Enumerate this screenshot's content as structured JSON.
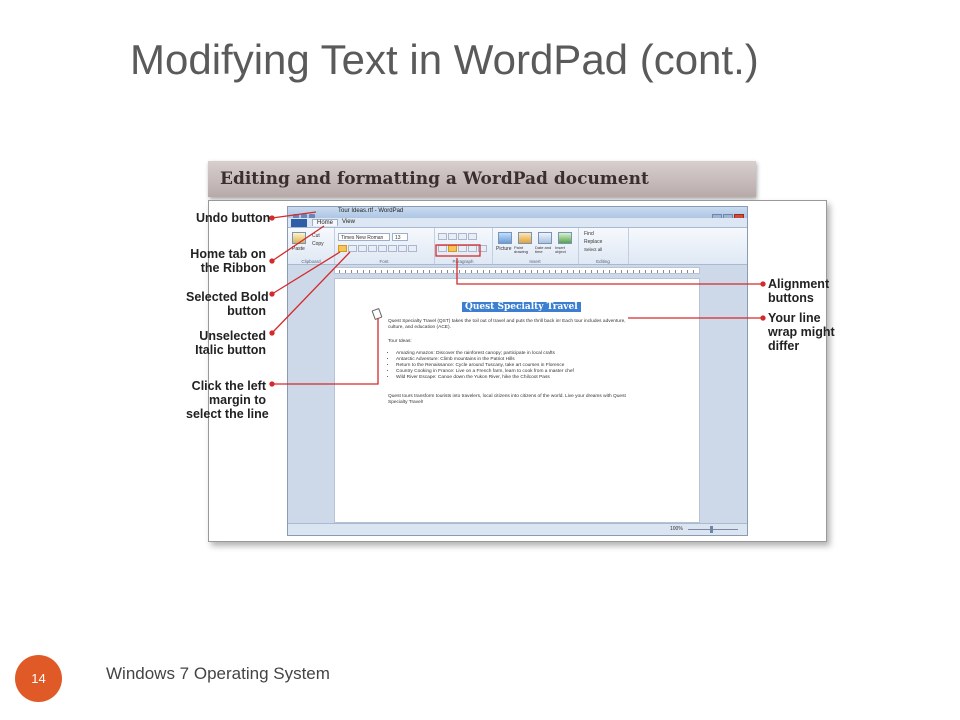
{
  "slide": {
    "title": "Modifying Text in WordPad (cont.)",
    "figure_caption": "Editing and formatting a WordPad document",
    "number": "14",
    "footer": "Windows 7 Operating System"
  },
  "callouts": {
    "undo": [
      "Undo button"
    ],
    "home_tab": [
      "Home tab on",
      "the Ribbon"
    ],
    "bold": [
      "Selected Bold",
      "button"
    ],
    "italic": [
      "Unselected",
      "Italic button"
    ],
    "margin": [
      "Click the left",
      "margin to",
      "select the line"
    ],
    "alignment": [
      "Alignment",
      "buttons"
    ],
    "wrap": [
      "Your line",
      "wrap might",
      "differ"
    ]
  },
  "window": {
    "title": "Tour Ideas.rtf - WordPad",
    "tabs": {
      "home": "Home",
      "view": "View"
    },
    "ribbon": {
      "paste": "Paste",
      "cut": "Cut",
      "copy": "Copy",
      "font_name": "Times New Roman",
      "font_size": "13",
      "picture": "Picture",
      "paint_drawing": "Paint drawing",
      "date_time": "Date and time",
      "insert_object": "Insert object",
      "find": "Find",
      "replace": "Replace",
      "select_all": "Select all",
      "groups": {
        "clipboard": "Clipboard",
        "font": "Font",
        "paragraph": "Paragraph",
        "insert": "Insert",
        "editing": "Editing"
      }
    },
    "status": {
      "zoom": "100%"
    }
  },
  "document": {
    "title": "Quest Specialty Travel",
    "intro": "Quest Specialty Travel (QST) takes the toil out of travel and puts the thrill back in! Each tour includes adventure, culture, and education (ACE).",
    "tour_heading": "Tour Ideas:",
    "tours": [
      "Amazing Amazon: Discover the rainforest canopy; participate in local crafts",
      "Antarctic Adventure: Climb mountains in the Patriot Hills",
      "Return to the Renaissance: Cycle around Tuscany, take art courses in Florence",
      "Country Cooking in France: Live on a French farm, learn to cook from a master chef",
      "Wild River Escape: Canoe down the Yukon River, hike the Chilcoot Pass"
    ],
    "closing": "Quest tours transform tourists into travelers, local citizens into citizens of the world. Live your dreams with Quest Specialty Travel!"
  },
  "colors": {
    "callout_line": "#d42a2a",
    "slide_number_bg": "#e05a28",
    "doc_title_bg": "#3c7fd0"
  }
}
